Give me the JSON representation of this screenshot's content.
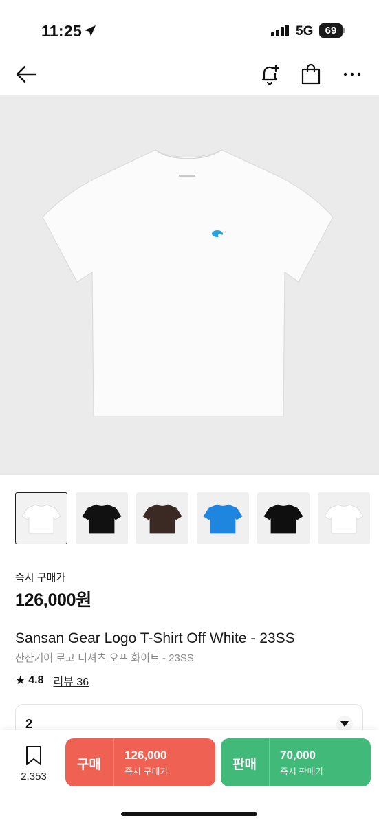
{
  "status_bar": {
    "time": "11:25",
    "network": "5G",
    "battery": "69"
  },
  "header": {
    "back_icon": "arrow-left-icon",
    "alert_icon": "bell-plus-icon",
    "bag_icon": "shopping-bag-icon",
    "more_icon": "more-horizontal-icon"
  },
  "thumbnails": [
    {
      "color": "#ffffff",
      "selected": true
    },
    {
      "color": "#111111",
      "selected": false
    },
    {
      "color": "#3b2a24",
      "selected": false
    },
    {
      "color": "#1f86e0",
      "selected": false
    },
    {
      "color": "#0f0f0f",
      "selected": false
    },
    {
      "color": "#ffffff",
      "selected": false
    }
  ],
  "product": {
    "price_label": "즉시 구매가",
    "price": "126,000원",
    "title_en": "Sansan Gear Logo T-Shirt Off White - 23SS",
    "title_ko": "산산기어 로고 티셔츠 오프 화이트 - 23SS",
    "rating": "4.8",
    "review": "리뷰 36"
  },
  "size_select": {
    "value": "2"
  },
  "bottom": {
    "wish_count": "2,353",
    "buy_label": "구매",
    "buy_price": "126,000",
    "buy_sub": "즉시 구매가",
    "sell_label": "판매",
    "sell_price": "70,000",
    "sell_sub": "즉시 판매가"
  },
  "colors": {
    "buy": "#ef6253",
    "sell": "#41b979",
    "image_bg": "#ebebeb"
  }
}
